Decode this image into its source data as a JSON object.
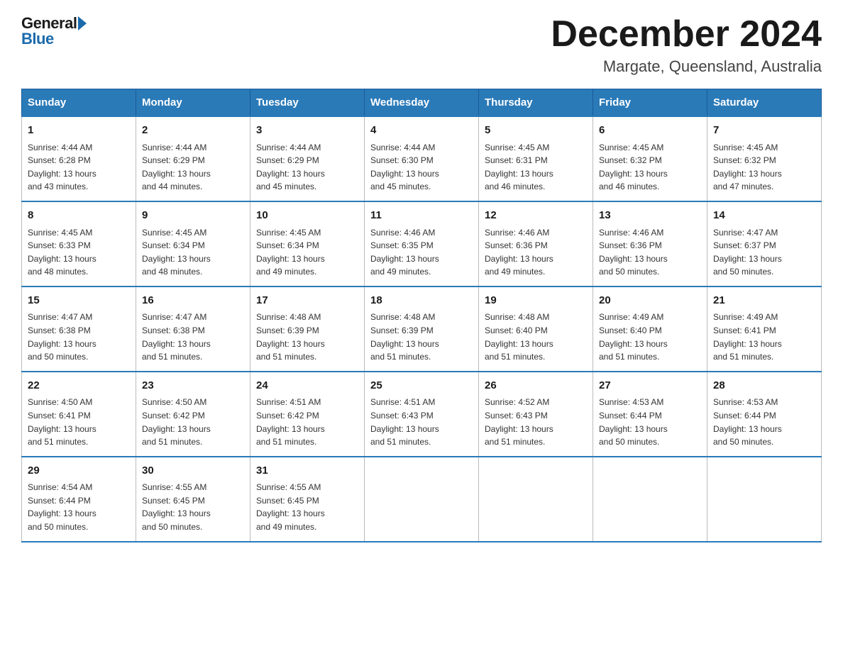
{
  "header": {
    "logo": {
      "general": "General",
      "blue": "Blue"
    },
    "title": "December 2024",
    "location": "Margate, Queensland, Australia"
  },
  "days_of_week": [
    "Sunday",
    "Monday",
    "Tuesday",
    "Wednesday",
    "Thursday",
    "Friday",
    "Saturday"
  ],
  "weeks": [
    [
      {
        "day": "1",
        "sunrise": "4:44 AM",
        "sunset": "6:28 PM",
        "daylight": "13 hours and 43 minutes."
      },
      {
        "day": "2",
        "sunrise": "4:44 AM",
        "sunset": "6:29 PM",
        "daylight": "13 hours and 44 minutes."
      },
      {
        "day": "3",
        "sunrise": "4:44 AM",
        "sunset": "6:29 PM",
        "daylight": "13 hours and 45 minutes."
      },
      {
        "day": "4",
        "sunrise": "4:44 AM",
        "sunset": "6:30 PM",
        "daylight": "13 hours and 45 minutes."
      },
      {
        "day": "5",
        "sunrise": "4:45 AM",
        "sunset": "6:31 PM",
        "daylight": "13 hours and 46 minutes."
      },
      {
        "day": "6",
        "sunrise": "4:45 AM",
        "sunset": "6:32 PM",
        "daylight": "13 hours and 46 minutes."
      },
      {
        "day": "7",
        "sunrise": "4:45 AM",
        "sunset": "6:32 PM",
        "daylight": "13 hours and 47 minutes."
      }
    ],
    [
      {
        "day": "8",
        "sunrise": "4:45 AM",
        "sunset": "6:33 PM",
        "daylight": "13 hours and 48 minutes."
      },
      {
        "day": "9",
        "sunrise": "4:45 AM",
        "sunset": "6:34 PM",
        "daylight": "13 hours and 48 minutes."
      },
      {
        "day": "10",
        "sunrise": "4:45 AM",
        "sunset": "6:34 PM",
        "daylight": "13 hours and 49 minutes."
      },
      {
        "day": "11",
        "sunrise": "4:46 AM",
        "sunset": "6:35 PM",
        "daylight": "13 hours and 49 minutes."
      },
      {
        "day": "12",
        "sunrise": "4:46 AM",
        "sunset": "6:36 PM",
        "daylight": "13 hours and 49 minutes."
      },
      {
        "day": "13",
        "sunrise": "4:46 AM",
        "sunset": "6:36 PM",
        "daylight": "13 hours and 50 minutes."
      },
      {
        "day": "14",
        "sunrise": "4:47 AM",
        "sunset": "6:37 PM",
        "daylight": "13 hours and 50 minutes."
      }
    ],
    [
      {
        "day": "15",
        "sunrise": "4:47 AM",
        "sunset": "6:38 PM",
        "daylight": "13 hours and 50 minutes."
      },
      {
        "day": "16",
        "sunrise": "4:47 AM",
        "sunset": "6:38 PM",
        "daylight": "13 hours and 51 minutes."
      },
      {
        "day": "17",
        "sunrise": "4:48 AM",
        "sunset": "6:39 PM",
        "daylight": "13 hours and 51 minutes."
      },
      {
        "day": "18",
        "sunrise": "4:48 AM",
        "sunset": "6:39 PM",
        "daylight": "13 hours and 51 minutes."
      },
      {
        "day": "19",
        "sunrise": "4:48 AM",
        "sunset": "6:40 PM",
        "daylight": "13 hours and 51 minutes."
      },
      {
        "day": "20",
        "sunrise": "4:49 AM",
        "sunset": "6:40 PM",
        "daylight": "13 hours and 51 minutes."
      },
      {
        "day": "21",
        "sunrise": "4:49 AM",
        "sunset": "6:41 PM",
        "daylight": "13 hours and 51 minutes."
      }
    ],
    [
      {
        "day": "22",
        "sunrise": "4:50 AM",
        "sunset": "6:41 PM",
        "daylight": "13 hours and 51 minutes."
      },
      {
        "day": "23",
        "sunrise": "4:50 AM",
        "sunset": "6:42 PM",
        "daylight": "13 hours and 51 minutes."
      },
      {
        "day": "24",
        "sunrise": "4:51 AM",
        "sunset": "6:42 PM",
        "daylight": "13 hours and 51 minutes."
      },
      {
        "day": "25",
        "sunrise": "4:51 AM",
        "sunset": "6:43 PM",
        "daylight": "13 hours and 51 minutes."
      },
      {
        "day": "26",
        "sunrise": "4:52 AM",
        "sunset": "6:43 PM",
        "daylight": "13 hours and 51 minutes."
      },
      {
        "day": "27",
        "sunrise": "4:53 AM",
        "sunset": "6:44 PM",
        "daylight": "13 hours and 50 minutes."
      },
      {
        "day": "28",
        "sunrise": "4:53 AM",
        "sunset": "6:44 PM",
        "daylight": "13 hours and 50 minutes."
      }
    ],
    [
      {
        "day": "29",
        "sunrise": "4:54 AM",
        "sunset": "6:44 PM",
        "daylight": "13 hours and 50 minutes."
      },
      {
        "day": "30",
        "sunrise": "4:55 AM",
        "sunset": "6:45 PM",
        "daylight": "13 hours and 50 minutes."
      },
      {
        "day": "31",
        "sunrise": "4:55 AM",
        "sunset": "6:45 PM",
        "daylight": "13 hours and 49 minutes."
      },
      null,
      null,
      null,
      null
    ]
  ],
  "labels": {
    "sunrise": "Sunrise:",
    "sunset": "Sunset:",
    "daylight": "Daylight:"
  }
}
